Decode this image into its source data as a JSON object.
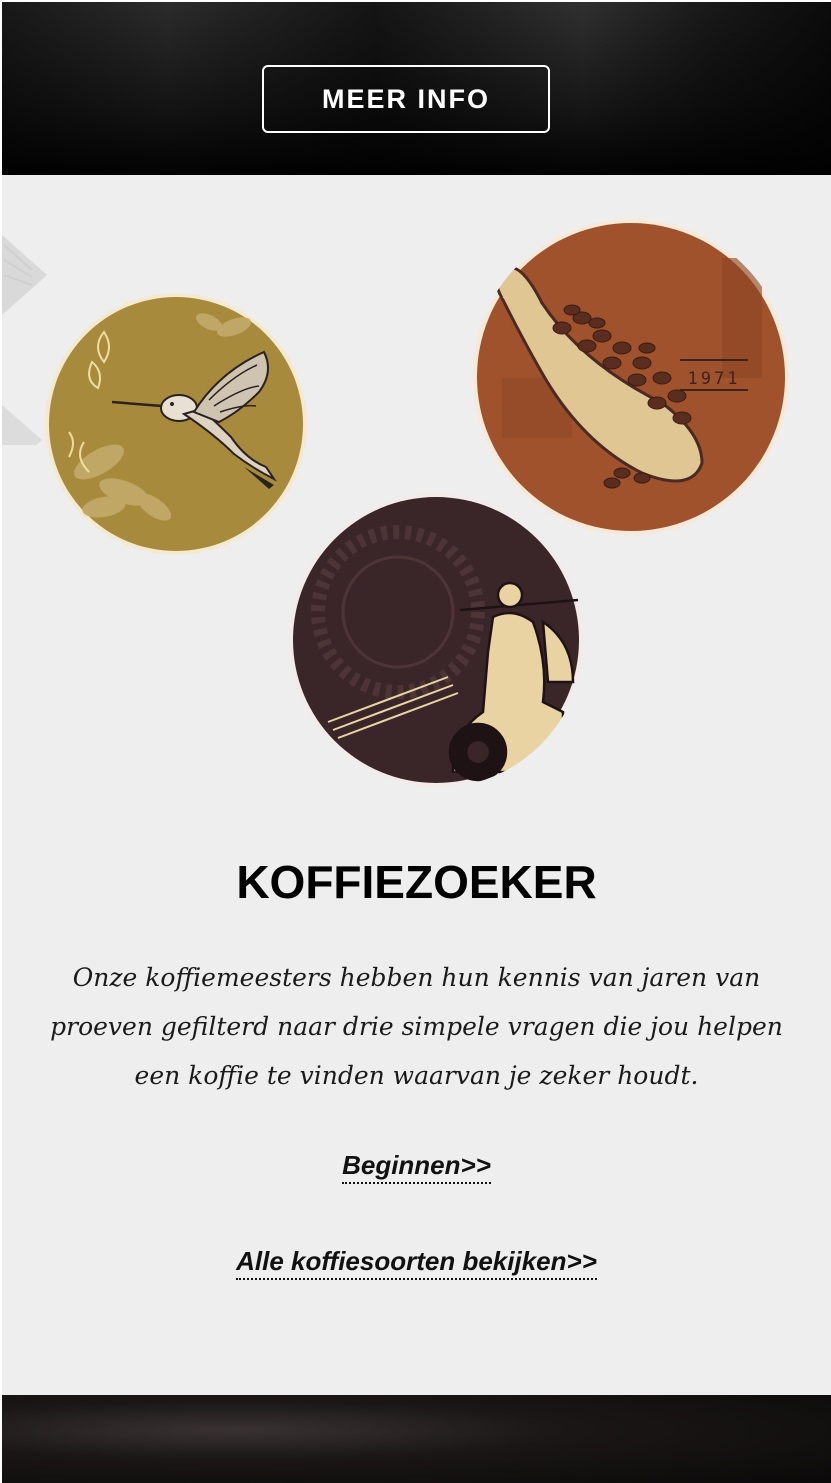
{
  "hero": {
    "button_label": "MEER INFO"
  },
  "illustrations": {
    "hummingbird": {
      "icon": "hummingbird-icon",
      "color": "#a88a3c"
    },
    "coffee_scoop": {
      "icon": "coffee-scoop-icon",
      "color": "#a0522d",
      "stamp_text": "1971"
    },
    "scooter": {
      "icon": "scooter-icon",
      "color": "#3a2628"
    }
  },
  "section": {
    "title": "KOFFIEZOEKER",
    "description": "Onze koffiemeesters hebben hun kennis van jaren van proeven gefilterd naar drie simpele vragen die jou helpen een koffie te vinden waarvan je zeker houdt.",
    "start_link": "Beginnen>>",
    "all_link": "Alle koffiesoorten bekijken>>"
  },
  "colors": {
    "background": "#eeeeee",
    "dark": "#111111",
    "gold": "#a88a3c",
    "rust": "#a0522d",
    "brown": "#3a2628",
    "cream": "#e9d3a3"
  }
}
